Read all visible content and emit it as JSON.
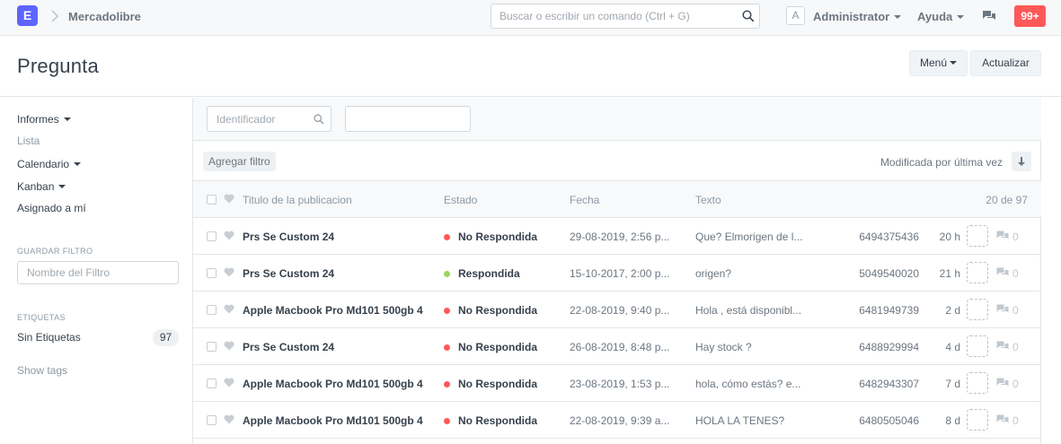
{
  "navbar": {
    "logo_letter": "E",
    "breadcrumb": "Mercadolibre",
    "search_placeholder": "Buscar o escribir un comando (Ctrl + G)",
    "avatar_letter": "A",
    "user_label": "Administrator",
    "help_label": "Ayuda",
    "notification_count": "99+"
  },
  "page": {
    "title": "Pregunta",
    "menu_label": "Menú",
    "refresh_label": "Actualizar"
  },
  "sidebar": {
    "views": [
      "Informes",
      "Lista",
      "Calendario",
      "Kanban",
      "Asignado a mí"
    ],
    "save_filter_heading": "GUARDAR FILTRO",
    "filter_name_placeholder": "Nombre del Filtro",
    "tags_heading": "ETIQUETAS",
    "tag_label": "Sin Etiquetas",
    "tag_count": "97",
    "show_tags": "Show tags"
  },
  "filters": {
    "id_placeholder": "Identificador",
    "add_filter_label": "Agregar filtro",
    "sort_label": "Modificada por última vez"
  },
  "list": {
    "headers": {
      "title": "Titulo de la publicacion",
      "status": "Estado",
      "date": "Fecha",
      "text": "Texto",
      "count": "20 de 97"
    },
    "status_colors": {
      "No Respondida": "#ff5858",
      "Respondida": "#98d85b"
    },
    "rows": [
      {
        "title": "Prs Se Custom 24",
        "status": "No Respondida",
        "date": "29-08-2019, 2:56 p...",
        "text": "Que? Elmorigen de l...",
        "id": "6494375436",
        "time": "20 h",
        "comments": "0"
      },
      {
        "title": "Prs Se Custom 24",
        "status": "Respondida",
        "date": "15-10-2017, 2:00 p...",
        "text": "origen?",
        "id": "5049540020",
        "time": "21 h",
        "comments": "0"
      },
      {
        "title": "Apple Macbook Pro Md101 500gb 4",
        "status": "No Respondida",
        "date": "22-08-2019, 9:40 p...",
        "text": "Hola , está disponibl...",
        "id": "6481949739",
        "time": "2 d",
        "comments": "0"
      },
      {
        "title": "Prs Se Custom 24",
        "status": "No Respondida",
        "date": "26-08-2019, 8:48 p...",
        "text": "Hay stock ?",
        "id": "6488929994",
        "time": "4 d",
        "comments": "0"
      },
      {
        "title": "Apple Macbook Pro Md101 500gb 4",
        "status": "No Respondida",
        "date": "23-08-2019, 1:53 p...",
        "text": "hola, cómo estás? e...",
        "id": "6482943307",
        "time": "7 d",
        "comments": "0"
      },
      {
        "title": "Apple Macbook Pro Md101 500gb 4",
        "status": "No Respondida",
        "date": "22-08-2019, 9:39 a...",
        "text": "HOLA LA TENES?",
        "id": "6480505046",
        "time": "8 d",
        "comments": "0"
      }
    ]
  }
}
